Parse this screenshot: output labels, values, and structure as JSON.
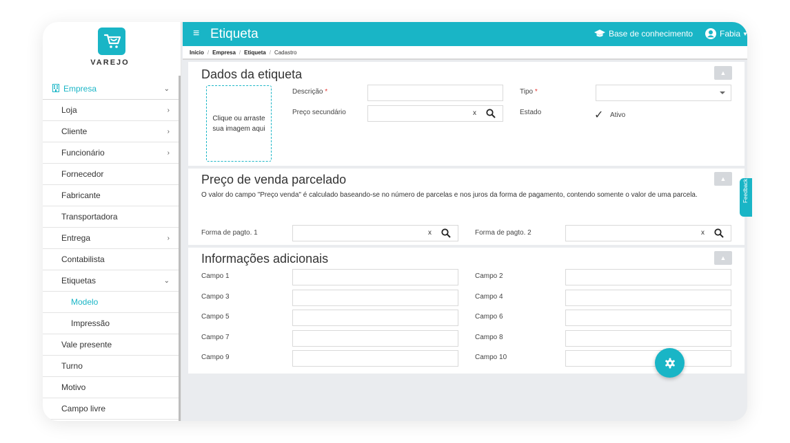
{
  "brand": {
    "name": "VAREJO",
    "color": "#19b5c6"
  },
  "header": {
    "title": "Etiqueta",
    "knowledge_base": "Base de conhecimento",
    "user": "Fabia"
  },
  "breadcrumb": [
    "Início",
    "Empresa",
    "Etiqueta",
    "Cadastro"
  ],
  "sidebar": {
    "section": "Empresa",
    "items": [
      {
        "label": "Loja",
        "chevron": "›"
      },
      {
        "label": "Cliente",
        "chevron": "›"
      },
      {
        "label": "Funcionário",
        "chevron": "›"
      },
      {
        "label": "Fornecedor"
      },
      {
        "label": "Fabricante"
      },
      {
        "label": "Transportadora"
      },
      {
        "label": "Entrega",
        "chevron": "›"
      },
      {
        "label": "Contabilista"
      },
      {
        "label": "Etiquetas",
        "chevron": "⌄"
      },
      {
        "label": "Modelo",
        "sub": true,
        "active": true
      },
      {
        "label": "Impressão",
        "sub": true
      },
      {
        "label": "Vale presente"
      },
      {
        "label": "Turno"
      },
      {
        "label": "Motivo"
      },
      {
        "label": "Campo livre"
      }
    ]
  },
  "dados": {
    "title": "Dados da etiqueta",
    "upload_text": "Clique ou arraste sua imagem aqui",
    "descricao_label": "Descrição",
    "preco_secundario_label": "Preço secundário",
    "tipo_label": "Tipo",
    "estado_label": "Estado",
    "ativo_label": "Ativo",
    "required_mark": "*",
    "clear": "x"
  },
  "parcelado": {
    "title": "Preço de venda parcelado",
    "description": "O valor do campo \"Preço venda\" é calculado baseando-se no número de parcelas e nos juros da forma de pagamento, contendo somente o valor de uma parcela.",
    "forma1_label": "Forma de pagto. 1",
    "forma2_label": "Forma de pagto. 2",
    "clear": "x"
  },
  "adicionais": {
    "title": "Informações adicionais",
    "campos": [
      "Campo 1",
      "Campo 2",
      "Campo 3",
      "Campo 4",
      "Campo 5",
      "Campo 6",
      "Campo 7",
      "Campo 8",
      "Campo 9",
      "Campo 10"
    ]
  },
  "feedback_tab": "Feedback",
  "icons": {
    "menu": "hamburger-icon",
    "graduation": "graduation-cap-icon",
    "user": "user-circle-icon",
    "search": "search-icon",
    "gear": "gear-icon",
    "collapse": "chevron-up-icon",
    "building": "building-icon"
  }
}
